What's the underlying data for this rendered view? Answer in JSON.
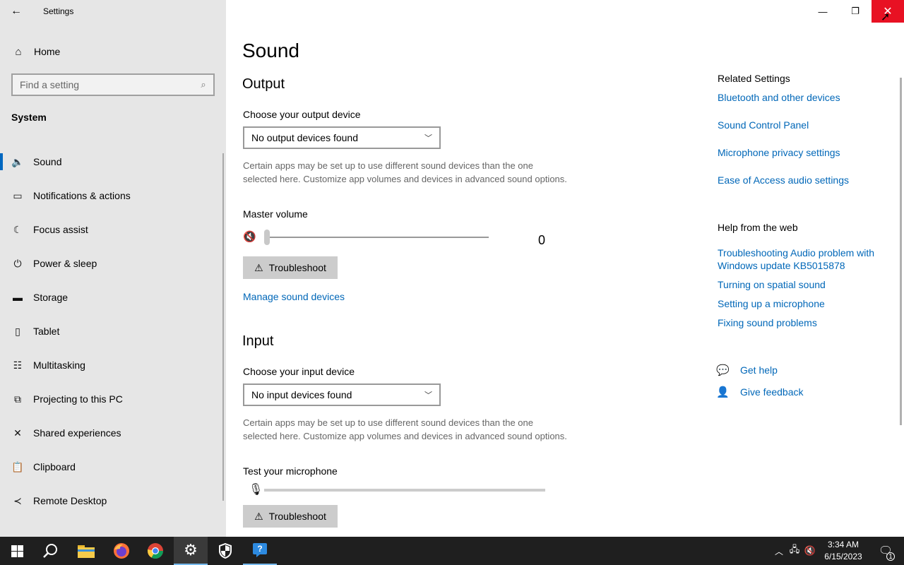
{
  "window": {
    "app_title": "Settings",
    "back_icon": "arrow-left-icon",
    "minimize_glyph": "—",
    "restore_glyph": "❐",
    "close_glyph": "✕",
    "close_color": "#e81123"
  },
  "sidebar": {
    "home_label": "Home",
    "search_placeholder": "Find a setting",
    "section_label": "System",
    "items": [
      {
        "label": "Sound",
        "icon": "speaker-icon",
        "selected": true
      },
      {
        "label": "Notifications & actions",
        "icon": "notification-icon"
      },
      {
        "label": "Focus assist",
        "icon": "moon-icon"
      },
      {
        "label": "Power & sleep",
        "icon": "power-icon"
      },
      {
        "label": "Storage",
        "icon": "storage-icon"
      },
      {
        "label": "Tablet",
        "icon": "tablet-icon"
      },
      {
        "label": "Multitasking",
        "icon": "multitasking-icon"
      },
      {
        "label": "Projecting to this PC",
        "icon": "projecting-icon"
      },
      {
        "label": "Shared experiences",
        "icon": "shared-icon"
      },
      {
        "label": "Clipboard",
        "icon": "clipboard-icon"
      },
      {
        "label": "Remote Desktop",
        "icon": "remote-desktop-icon"
      }
    ],
    "accent": "#0067c0"
  },
  "main": {
    "title": "Sound",
    "output": {
      "heading": "Output",
      "device_label": "Choose your output device",
      "device_value": "No output devices found",
      "help_text": "Certain apps may be set up to use different sound devices than the one selected here. Customize app volumes and devices in advanced sound options.",
      "volume_label": "Master volume",
      "volume_value": "0",
      "troubleshoot_label": "Troubleshoot",
      "manage_link": "Manage sound devices"
    },
    "input": {
      "heading": "Input",
      "device_label": "Choose your input device",
      "device_value": "No input devices found",
      "help_text": "Certain apps may be set up to use different sound devices than the one selected here. Customize app volumes and devices in advanced sound options.",
      "test_label": "Test your microphone",
      "mic_level": 0,
      "troubleshoot_label": "Troubleshoot"
    },
    "link_color": "#0067b8"
  },
  "related": {
    "heading": "Related Settings",
    "links": [
      "Bluetooth and other devices",
      "Sound Control Panel",
      "Microphone privacy settings",
      "Ease of Access audio settings"
    ],
    "help_heading": "Help from the web",
    "help_links": [
      "Troubleshooting Audio problem with Windows update KB5015878",
      "Turning on spatial sound",
      "Setting up a microphone",
      "Fixing sound problems"
    ],
    "get_help": "Get help",
    "give_feedback": "Give feedback"
  },
  "taskbar": {
    "time": "3:34 AM",
    "date": "6/15/2023",
    "notification_count": "1",
    "apps": [
      "start-icon",
      "search-icon",
      "file-explorer-icon",
      "firefox-icon",
      "chrome-icon",
      "settings-icon",
      "security-icon",
      "help-icon"
    ]
  }
}
